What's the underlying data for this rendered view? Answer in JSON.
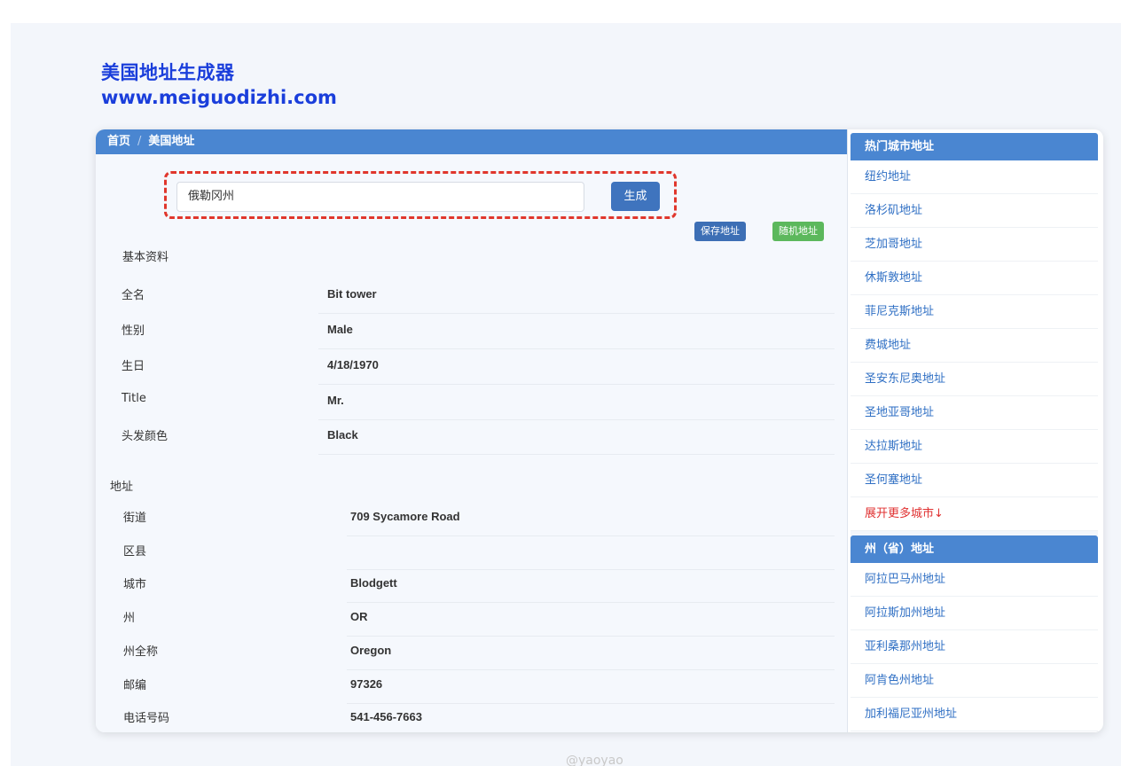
{
  "brand": {
    "title": "美国地址生成器",
    "url": "www.meiguodizhi.com"
  },
  "breadcrumb": {
    "home": "首页",
    "separator": "/",
    "current": "美国地址"
  },
  "search": {
    "value": "俄勒冈州",
    "button": "生成"
  },
  "actions": {
    "save": "保存地址",
    "random": "随机地址"
  },
  "basic": {
    "heading": "基本资料",
    "rows": [
      {
        "label": "全名",
        "value": "Bit tower"
      },
      {
        "label": "性别",
        "value": "Male"
      },
      {
        "label": "生日",
        "value": "4/18/1970"
      },
      {
        "label": "Title",
        "value": "Mr."
      },
      {
        "label": "头发颜色",
        "value": "Black"
      }
    ]
  },
  "address": {
    "heading": "地址",
    "rows": [
      {
        "label": "街道",
        "value": "709  Sycamore Road"
      },
      {
        "label": "区县",
        "value": ""
      },
      {
        "label": "城市",
        "value": "Blodgett"
      },
      {
        "label": "州",
        "value": "OR"
      },
      {
        "label": "州全称",
        "value": "Oregon"
      },
      {
        "label": "邮编",
        "value": "97326"
      },
      {
        "label": "电话号码",
        "value": "541-456-7663"
      }
    ]
  },
  "hot_cities": {
    "heading": "热门城市地址",
    "items": [
      "纽约地址",
      "洛杉矶地址",
      "芝加哥地址",
      "休斯敦地址",
      "菲尼克斯地址",
      "费城地址",
      "圣安东尼奥地址",
      "圣地亚哥地址",
      "达拉斯地址",
      "圣何塞地址"
    ],
    "more": "展开更多城市↓"
  },
  "states": {
    "heading": "州（省）地址",
    "items": [
      "阿拉巴马州地址",
      "阿拉斯加州地址",
      "亚利桑那州地址",
      "阿肯色州地址",
      "加利福尼亚州地址"
    ]
  },
  "watermark": "@yaoyao",
  "colors": {
    "brand": "#1a3edb",
    "header_bar": "#4a86d1",
    "link": "#2f6fc4",
    "highlight_border": "#e0362c",
    "random_button": "#5cb85c"
  }
}
